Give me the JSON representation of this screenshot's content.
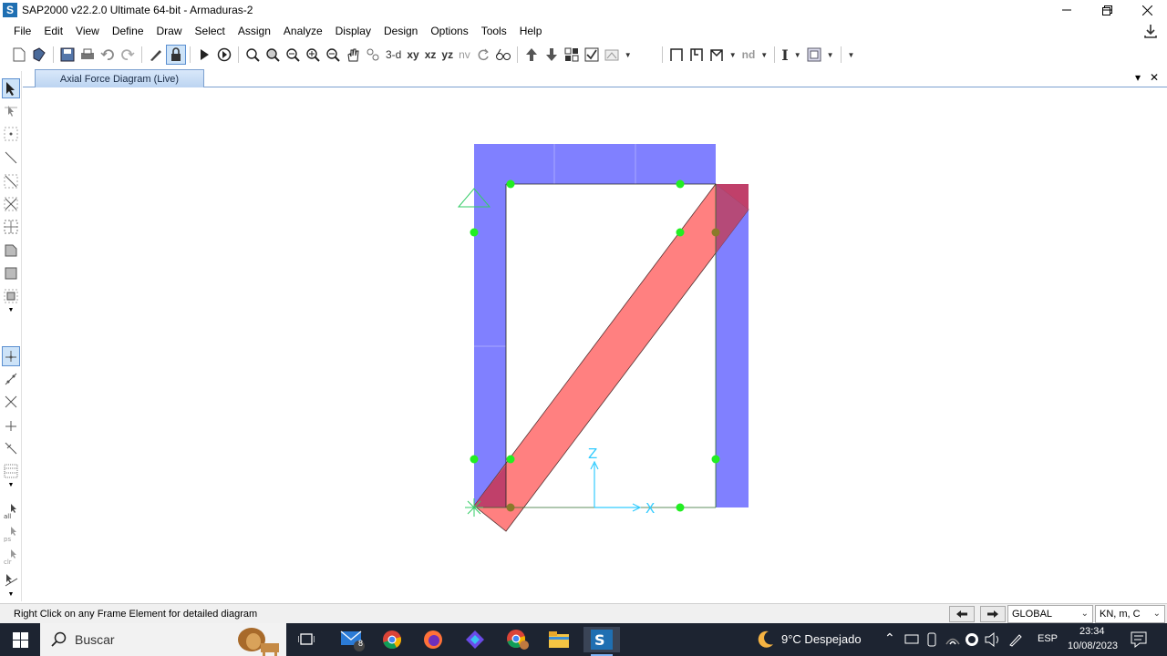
{
  "window": {
    "title": "SAP2000 v22.2.0 Ultimate 64-bit - Armaduras-2",
    "logo_letter": "S",
    "controls": [
      "minimize",
      "restore",
      "close"
    ]
  },
  "menu": [
    "File",
    "Edit",
    "View",
    "Define",
    "Draw",
    "Select",
    "Assign",
    "Analyze",
    "Display",
    "Design",
    "Options",
    "Tools",
    "Help"
  ],
  "toolbar": {
    "view_3d": "3-d",
    "view_xy": "xy",
    "view_xz": "xz",
    "view_yz": "yz",
    "view_nv": "nv",
    "nd": "nd",
    "text_tool": "I"
  },
  "tab": {
    "label": "Axial Force Diagram (Live)",
    "close": "✕",
    "dropdown": "▾"
  },
  "canvas": {
    "axis_z": "Z",
    "axis_x": "X",
    "colors": {
      "compression": "#8080ff",
      "tension": "#ff8080",
      "overlap": "#c0406a",
      "joint": "#22ee22",
      "axis": "#33ccff",
      "support": "#33cc66"
    }
  },
  "status": {
    "message": "Right Click on any Frame Element for detailed diagram",
    "coord_system": "GLOBAL",
    "units": "KN, m, C"
  },
  "taskbar": {
    "search_placeholder": "Buscar",
    "mail_badge": "8",
    "weather": "9°C  Despejado",
    "language": "ESP",
    "time": "23:34",
    "date": "10/08/2023"
  }
}
